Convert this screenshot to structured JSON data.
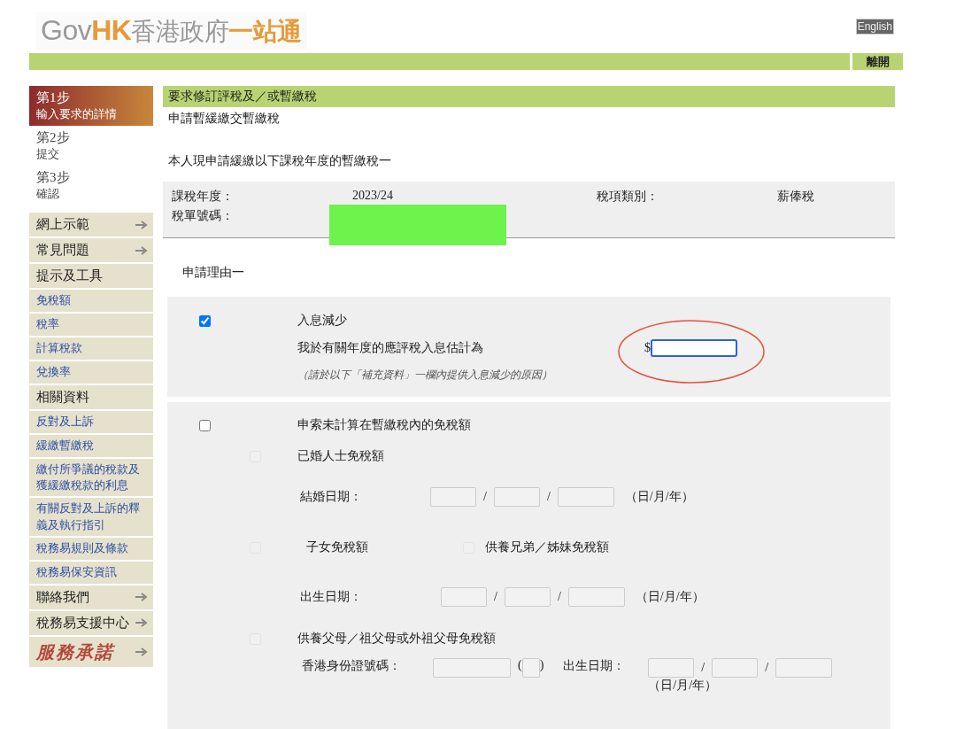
{
  "header": {
    "logo": [
      {
        "text": "Gov",
        "kind": "grey"
      },
      {
        "text": "HK",
        "kind": "orange"
      },
      {
        "text": "香港政府",
        "kind": "grey"
      },
      {
        "text": "一站通",
        "kind": "orange"
      }
    ],
    "language_button": "English",
    "exit_button": "離開"
  },
  "steps": [
    {
      "number": "第1步",
      "label": "輸入要求的詳情",
      "selected": true
    },
    {
      "number": "第2步",
      "label": "提交",
      "selected": false
    },
    {
      "number": "第3步",
      "label": "確認",
      "selected": false
    }
  ],
  "sidebar_menu": [
    {
      "label": "網上示範",
      "kind": "heading",
      "arrow": true
    },
    {
      "label": "常見問題",
      "kind": "heading",
      "arrow": true
    },
    {
      "label": "提示及工具",
      "kind": "heading",
      "arrow": false
    },
    {
      "label": "免稅額",
      "kind": "link",
      "arrow": false
    },
    {
      "label": "稅率",
      "kind": "link",
      "arrow": false
    },
    {
      "label": "計算稅款",
      "kind": "link",
      "arrow": false
    },
    {
      "label": "兌換率",
      "kind": "link",
      "arrow": false
    },
    {
      "label": "相關資料",
      "kind": "heading",
      "arrow": false
    },
    {
      "label": "反對及上訴",
      "kind": "link",
      "arrow": false
    },
    {
      "label": "緩繳暫繳稅",
      "kind": "link",
      "arrow": false
    },
    {
      "label": "繳付所爭議的稅款及獲緩繳稅款的利息",
      "kind": "link",
      "arrow": false
    },
    {
      "label": "有關反對及上訴的釋義及執行指引",
      "kind": "link",
      "arrow": false
    },
    {
      "label": "稅務易規則及條款",
      "kind": "link",
      "arrow": false
    },
    {
      "label": "稅務易保安資訊",
      "kind": "link",
      "arrow": false
    },
    {
      "label": "聯絡我們",
      "kind": "heading",
      "arrow": true
    },
    {
      "label": "稅務易支援中心",
      "kind": "heading",
      "arrow": true
    },
    {
      "label": "服務承諾",
      "kind": "script",
      "arrow": true
    }
  ],
  "page": {
    "title": "要求修訂評稅及／或暫繳稅",
    "subtitle": "申請暫緩繳交暫繳稅",
    "intro": "本人現申請緩繳以下課稅年度的暫繳稅一",
    "info": {
      "year_label": "課稅年度：",
      "year_value": "2023/24",
      "type_label": "稅項類別：",
      "type_value": "薪俸稅",
      "file_number_label": "稅單號碼："
    },
    "section_title": "申請理由一"
  },
  "reason_income": {
    "checked": true,
    "title": "入息減少",
    "estimate_label": "我於有關年度的應評稅入息估計為",
    "currency": "$",
    "note": "（請於以下「補充資料」一欄內提供入息減少的原因）"
  },
  "reason_allowance": {
    "checked": false,
    "title": "申索未計算在暫繳稅內的免稅額",
    "married": {
      "checked": false,
      "disabled": true,
      "label": "已婚人士免稅額",
      "date_label": "結婚日期：",
      "separators": [
        "/",
        "/"
      ],
      "date_format": "（日/月/年）"
    },
    "child": {
      "checked": false,
      "disabled": true,
      "label": "子女免稅額",
      "sibling_checked": false,
      "sibling_disabled": true,
      "sibling_label": "供養兄弟／姊妹免稅額",
      "date_label": "出生日期：",
      "separators": [
        "/",
        "/"
      ],
      "date_format": "（日/月/年）"
    },
    "parent": {
      "checked": false,
      "disabled": true,
      "label": "供養父母／祖父母或外祖父母免稅額",
      "id_label": "香港身份證號碼：",
      "paren_open": "(",
      "paren_close": ")",
      "date_label": "出生日期：",
      "separators": [
        "/",
        "/"
      ],
      "date_format": "（日/月/年）"
    }
  }
}
